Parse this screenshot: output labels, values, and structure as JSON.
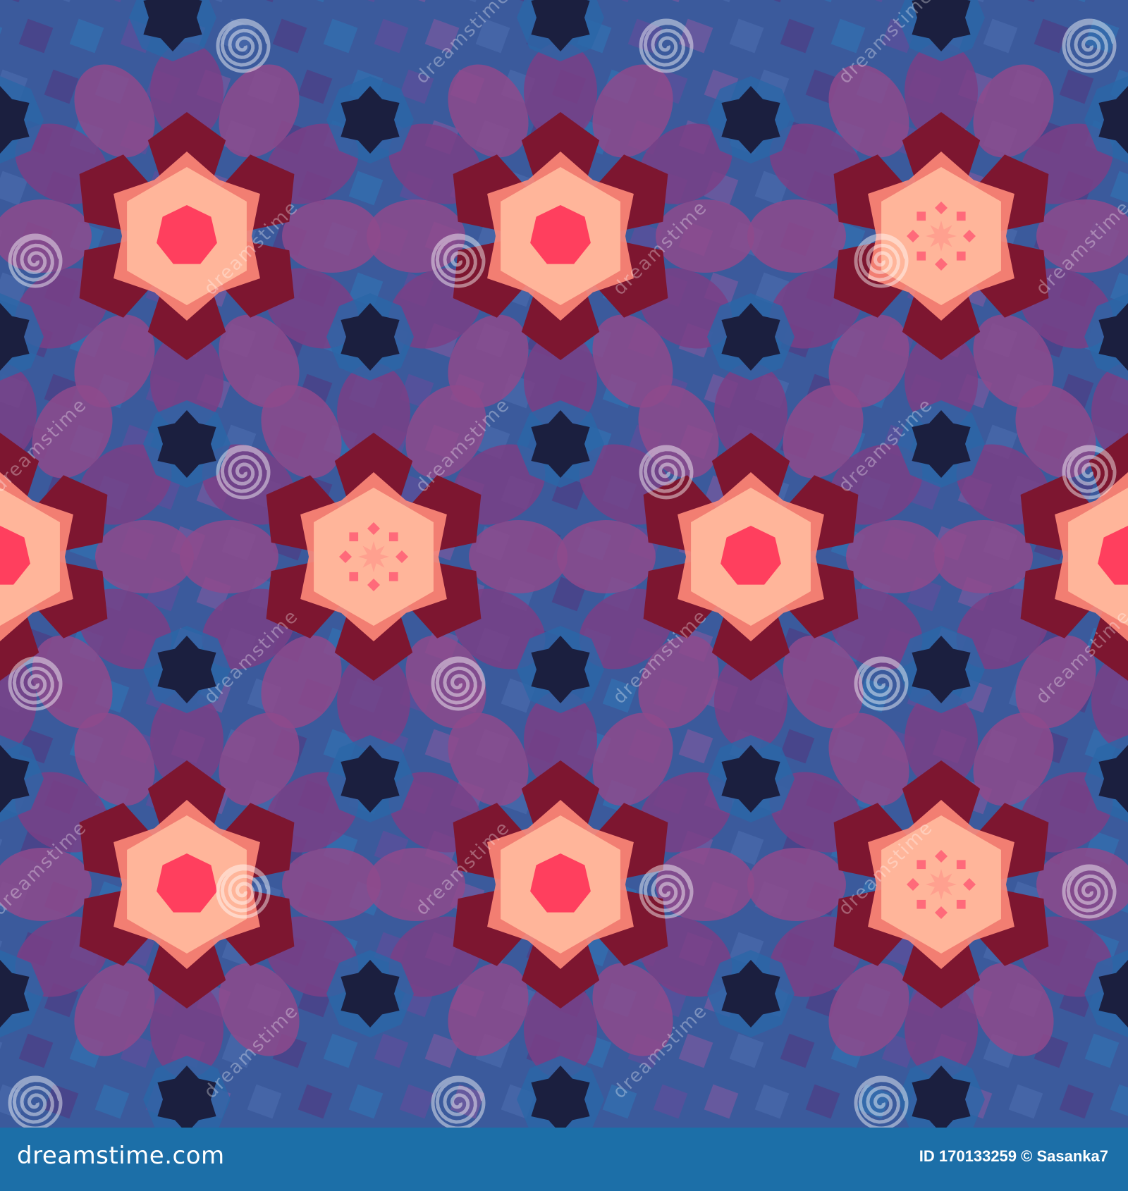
{
  "footer": {
    "brand": "dreamstime.com",
    "image_id": "ID 170133259 © Sasanka7"
  },
  "watermark": {
    "text": "dreamstime",
    "icon": "spiral-logo-icon"
  },
  "colors": {
    "background_blue": "#3b5a9c",
    "purple": "#7a3f86",
    "violet": "#54357e",
    "dark_red": "#7d1630",
    "peach": "#ffb59a",
    "coral": "#ff3f5e",
    "navy": "#1b1f3f",
    "footer": "#1c6fa8"
  }
}
